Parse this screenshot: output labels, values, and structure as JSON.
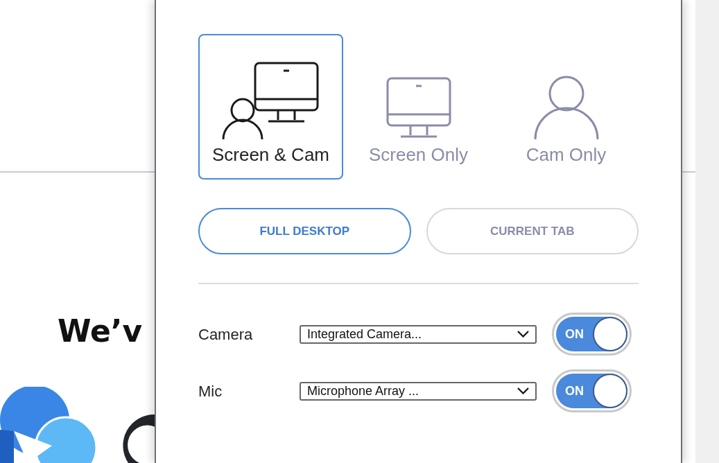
{
  "background_page": {
    "heading": "We’v"
  },
  "modes": [
    {
      "kind": "screen_cam",
      "label": "Screen & Cam",
      "selected": true
    },
    {
      "kind": "screen",
      "label": "Screen Only",
      "selected": false
    },
    {
      "kind": "cam",
      "label": "Cam Only",
      "selected": false
    }
  ],
  "capture_targets": [
    {
      "label": "FULL DESKTOP",
      "selected": true
    },
    {
      "label": "CURRENT TAB",
      "selected": false
    }
  ],
  "devices": [
    {
      "label": "Camera",
      "value": "Integrated Camera...",
      "toggle_label": "ON",
      "on": true
    },
    {
      "label": "Mic",
      "value": "Microphone Array ...",
      "toggle_label": "ON",
      "on": true
    }
  ]
}
